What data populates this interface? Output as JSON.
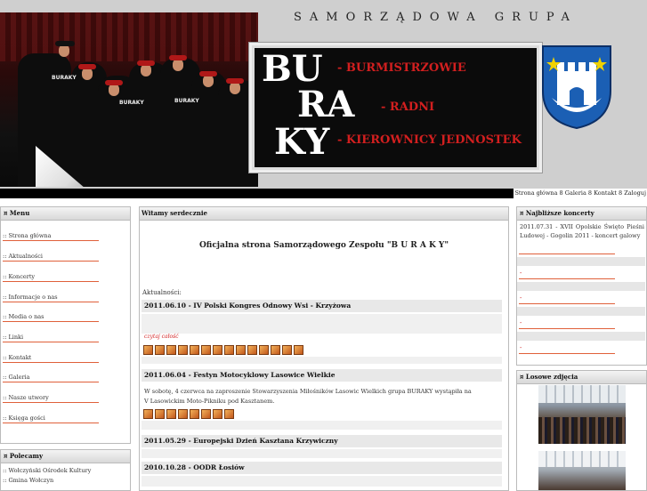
{
  "header": {
    "tagline": "SAMORZĄDOWA GRUPA",
    "logo": {
      "letters_row1": "BU",
      "letters_row2": "RA",
      "letters_row3": "KY",
      "line1": "- BURMISTRZOWIE",
      "line2": "- RADNI",
      "line3": "- KIEROWNICY JEDNOSTEK"
    },
    "photo_shirt_text": [
      "BURAKY",
      "BURAKY",
      "BURAKY"
    ],
    "colors": {
      "accent_red": "#d21f1f",
      "logo_bg": "#0b0b0b",
      "coat_blue": "#1b5fb4"
    }
  },
  "topnav": {
    "items": [
      "Strona główna",
      "Galeria",
      "Kontakt",
      "Zaloguj"
    ],
    "separator": "8"
  },
  "left_menu": {
    "title": "Menu",
    "bullet": "¤",
    "items": [
      ":: Strona główna",
      ":: Aktualności",
      ":: Koncerty",
      ":: Informacje o nas",
      ":: Media o nas",
      ":: Linki",
      ":: Kontakt",
      ":: Galeria",
      ":: Nasze utwory",
      ":: Księga gości"
    ]
  },
  "left_recommended": {
    "title": "Polecamy",
    "items": [
      ":: Wołczyński Ośrodek Kultury",
      ":: Gmina Wołczyn"
    ]
  },
  "center": {
    "title": "Witamy serdecznie",
    "headline": "Oficjalna strona Samorządowego Zespołu \"B U R A K Y\"",
    "news_label": "Aktualności:",
    "news": [
      {
        "title": "2011.06.10 - IV Polski Kongres Odnowy Wsi - Krzyżowa",
        "more": "czytaj całość",
        "thumbs": 14
      },
      {
        "title": "2011.06.04 - Festyn Motocyklowy Lasowice Wielkie",
        "body1": "W sobotę, 4 czerwca na zaproszenie Stowarzyszenia Miłośników Lasowic Wielkich grupa BURAKY wystąpiła na",
        "body2": "V Lasowickim Moto-Pikniku pod Kasztanem.",
        "thumbs": 8
      },
      {
        "title": "2011.05.29 - Europejski Dzień Kasztana Krzywiczny"
      },
      {
        "title": "2010.10.28 - OODR Łosiów"
      }
    ]
  },
  "right_concerts": {
    "title": "Najbliższe koncerty",
    "entry": "2011.07.31 - XVII Opolskie Święto Pieśni Ludowej - Gogolin 2011 - koncert galowy",
    "placeholders": [
      "-",
      "-",
      "-",
      "-"
    ]
  },
  "right_photos": {
    "title": "Losowe zdjęcia"
  }
}
